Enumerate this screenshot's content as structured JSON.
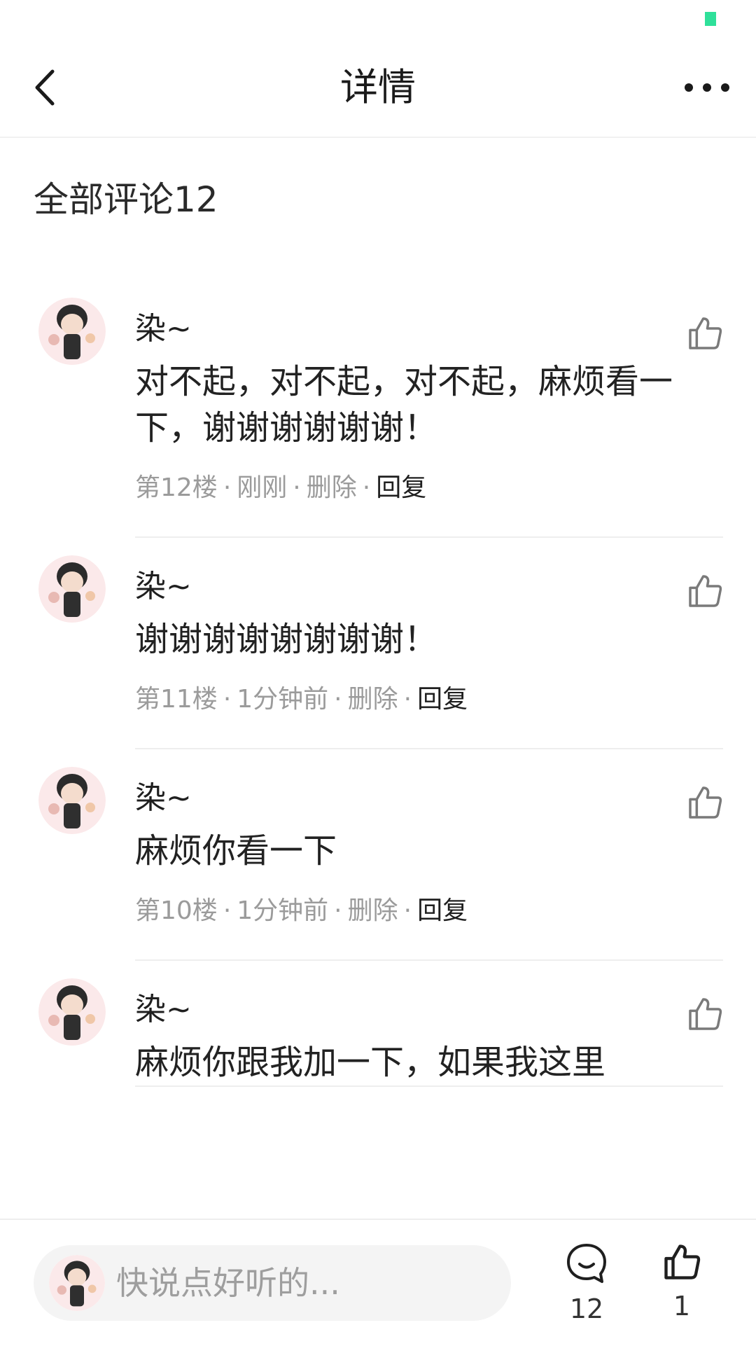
{
  "header": {
    "title": "详情"
  },
  "section": {
    "title": "全部评论12"
  },
  "comments": [
    {
      "username": "染~",
      "text": "对不起，对不起，对不起，麻烦看一下，谢谢谢谢谢谢！",
      "floor": "第12楼",
      "time": "刚刚",
      "delete": "删除",
      "reply": "回复"
    },
    {
      "username": "染~",
      "text": "谢谢谢谢谢谢谢谢！",
      "floor": "第11楼",
      "time": "1分钟前",
      "delete": "删除",
      "reply": "回复"
    },
    {
      "username": "染~",
      "text": "麻烦你看一下",
      "floor": "第10楼",
      "time": "1分钟前",
      "delete": "删除",
      "reply": "回复"
    },
    {
      "username": "染~",
      "text": "麻烦你跟我加一下，如果我这里",
      "floor": "",
      "time": "",
      "delete": "",
      "reply": ""
    }
  ],
  "bottom_bar": {
    "placeholder": "快说点好听的...",
    "comment_count": "12",
    "like_count": "1"
  },
  "colors": {
    "status_indicator": "#2fe09a",
    "meta_text": "#9b9b9b",
    "divider": "#eeeeee",
    "input_background": "#f4f4f4"
  },
  "icons": {
    "back": "chevron-left-icon",
    "more": "more-dots-icon",
    "like": "thumbs-up-icon",
    "comment": "chat-bubble-icon"
  }
}
